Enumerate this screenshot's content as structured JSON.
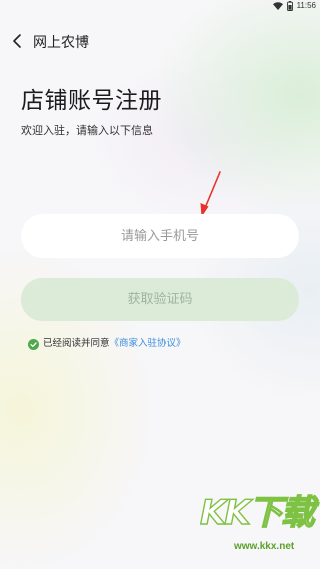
{
  "status_bar": {
    "time": "11:56",
    "icons": [
      "wifi-icon",
      "battery-icon"
    ]
  },
  "header": {
    "title": "网上农博",
    "back_icon": "chevron-left-icon"
  },
  "page": {
    "title": "店铺账号注册",
    "subtitle": "欢迎入驻，请输入以下信息"
  },
  "form": {
    "phone_placeholder": "请输入手机号",
    "phone_value": "",
    "get_code_label": "获取验证码",
    "get_code_enabled": false
  },
  "agreement": {
    "checked": true,
    "text": "已经阅读并同意",
    "link_text": "《商家入驻协议》"
  },
  "annotation": {
    "icon": "arrow-icon",
    "color": "#e8322b"
  },
  "watermark": {
    "text": "KK下载",
    "url": "www.kkx.net"
  },
  "colors": {
    "accent_green": "#4fa84a",
    "disabled_button": "#dcebd8",
    "disabled_button_text": "#9fb59b",
    "link": "#3a8ee0"
  }
}
